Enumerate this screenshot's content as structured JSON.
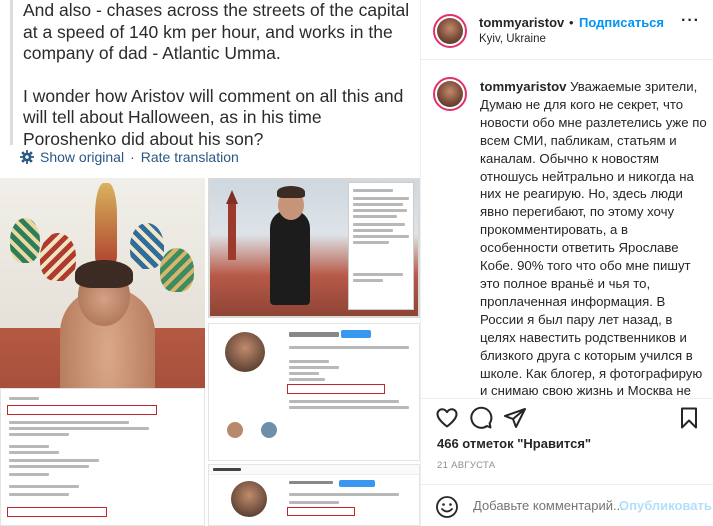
{
  "translated_post": {
    "paragraph1": "And also - chases across the streets of the capital at a speed of 140 km per hour, and works in the company of dad - Atlantic Umma.",
    "paragraph2": "I wonder how Aristov will comment on all this and will tell about Halloween, as in his time Poroshenko did about his son?",
    "show_original": "Show original",
    "separator": "·",
    "rate_translation": "Rate translation",
    "gear_icon": "gear-icon"
  },
  "instagram": {
    "username": "tommyaristov",
    "dot": "•",
    "follow_label": "Подписаться",
    "location": "Kyiv, Ukraine",
    "more_label": "···",
    "caption_text": "Уважаемые зрители, Думаю не для кого не секрет, что новости обо мне разлетелись уже по всем СМИ, пабликам, статьям и каналам. Обычно к новостям отношусь нейтрально и никогда на них не реагирую. Но, здесь люди явно перегибают, по этому хочу прокомментировать, а в особенности ответить Ярославе Кобе. 90% того что обо мне пишут это полное враньё и чья то, проплаченная информация. В России я был пару лет назад, в целях навестить родственников и близкого друга с которым учился в школе. Как блогер, я фотографирую и снимаю свою жизнь и Москва не стала исключением. Видео были в",
    "likes_text": "466 отметок \"Нравится\"",
    "date_text": "21 АВГУСТА",
    "comment_placeholder": "Добавьте комментарий...",
    "publish_label": "Опубликовать",
    "icons": [
      "heart-icon",
      "comment-icon",
      "share-icon",
      "bookmark-icon",
      "smile-icon"
    ],
    "colors": {
      "link_blue": "#0095f6",
      "vk_blue": "#2a5885",
      "muted": "#8e8e8e",
      "story_ring": "#e1306c",
      "highlight_red": "#c0262c"
    }
  }
}
